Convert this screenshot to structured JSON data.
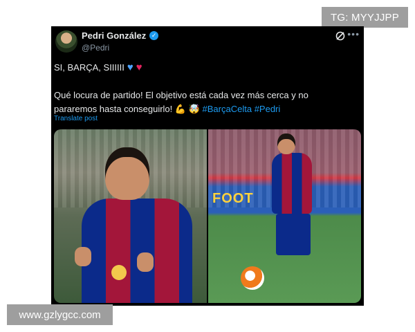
{
  "watermarks": {
    "tg": "TG: MYYJJPP",
    "site": "www.gzlygcc.com"
  },
  "tweet": {
    "display_name": "Pedri González",
    "handle": "@Pedri",
    "verified": true,
    "line1": "SI, BARÇA, SIIIIII",
    "body": "Qué locura de partido! El objetivo está cada vez más cerca y no pararemos hasta conseguirlo!",
    "hashtags": [
      "#BarçaCelta",
      "#Pedri"
    ],
    "translate": "Translate post",
    "media_ad_text": "FOOT",
    "emoji_icons": [
      "blue-heart",
      "red-heart",
      "flexed-biceps",
      "exploding-head"
    ]
  },
  "colors": {
    "background": "#000000",
    "text": "#e7e9ea",
    "secondary_text": "#8b98a5",
    "link": "#1d9bf0",
    "watermark_bg": "#9e9e9e"
  }
}
